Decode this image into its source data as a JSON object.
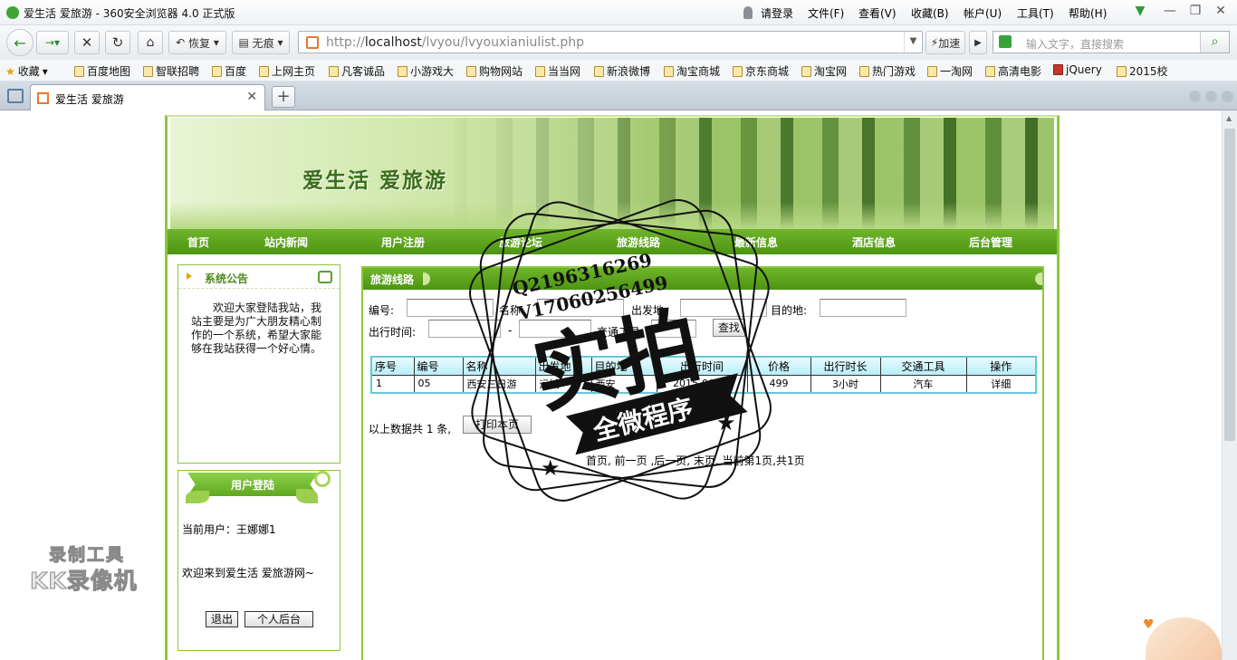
{
  "browser": {
    "window_title": "爱生活 爱旅游 - 360安全浏览器 4.0 正式版",
    "menus": [
      "请登录",
      "文件(F)",
      "查看(V)",
      "收藏(B)",
      "帐户(U)",
      "工具(T)",
      "帮助(H)"
    ],
    "restore_label": "恢复",
    "incognito_label": "无痕",
    "url_prefix": "http://",
    "url_host": "localhost",
    "url_path": "/lvyou/lvyouxianiulist.php",
    "accelerate_label": "加速",
    "search_placeholder": "输入文字，直接搜索",
    "bookmarks": [
      "收藏",
      "百度地图",
      "智联招聘",
      "百度",
      "上网主页",
      "凡客诚品",
      "小游戏大",
      "购物网站",
      "当当网",
      "新浪微博",
      "淘宝商城",
      "京东商城",
      "淘宝网",
      "热门游戏",
      "一淘网",
      "高清电影",
      "jQuery",
      "2015校"
    ],
    "tab_title": "爱生活 爱旅游"
  },
  "site": {
    "banner_title": "爱生活  爱旅游",
    "nav": [
      "首页",
      "站内新闻",
      "用户注册",
      "旅游论坛",
      "旅游线路",
      "最新信息",
      "酒店信息",
      "后台管理"
    ],
    "notice_title": "系统公告",
    "notice_body": "欢迎大家登陆我站，我站主要是为广大朋友精心制作的一个系统，希望大家能够在我站获得一个好心情。",
    "login_title": "用户登陆",
    "current_user": "当前用户：王娜娜1",
    "welcome": "欢迎来到爱生活 爱旅游网~",
    "logout_label": "退出",
    "backend_label": "个人后台"
  },
  "content": {
    "title": "旅游线路",
    "search": {
      "id_label": "编号:",
      "name_label": "名称:",
      "from_label": "出发地:",
      "dest_label": "目的地:",
      "time_label": "出行时间:",
      "range_sep": "-",
      "transport_label": "交通工具:",
      "search_button": "查找"
    },
    "columns": [
      "序号",
      "编号",
      "名称",
      "出发地",
      "目的地",
      "出行时间",
      "价格",
      "出行时长",
      "交通工具",
      "操作"
    ],
    "rows": [
      [
        "1",
        "05",
        "西安三日游",
        "运城",
        "西安",
        "2015-06-14",
        "499",
        "3小时",
        "汽车",
        "详细"
      ]
    ],
    "summary": "以上数据共  1  条,",
    "print_button": "打印本页",
    "pagination": "首页,  前一页  ,后一页,  末页,  当前第1页,共1页"
  },
  "overlay": {
    "stamp_line1": "Q2196316269",
    "stamp_line2": "V17060256499",
    "stamp_main": "实拍",
    "stamp_banner": "全微程序",
    "recorder_line1": "录制工具",
    "recorder_line2": "KK录像机"
  }
}
